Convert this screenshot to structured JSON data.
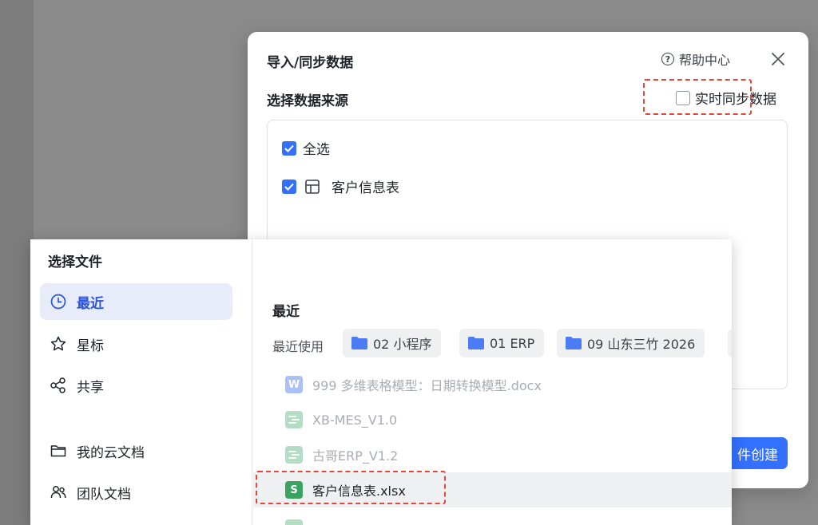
{
  "import_dialog": {
    "title": "导入/同步数据",
    "help_label": "帮助中心",
    "source_label": "选择数据来源",
    "realtime_sync_label": "实时同步数据",
    "select_all_label": "全选",
    "table_item_label": "客户信息表",
    "create_button_label": "件创建"
  },
  "file_picker": {
    "title": "选择文件",
    "nav": {
      "recent": "最近",
      "starred": "星标",
      "shared": "共享",
      "my_docs": "我的云文档",
      "team_docs": "团队文档"
    },
    "section_title": "最近",
    "recent_used_label": "最近使用",
    "folders": [
      "02 小程序",
      "01 ERP",
      "09 山东三竹 2026"
    ],
    "files": [
      {
        "name": "999 多维表格模型：日期转换模型.docx",
        "icon": "word-icon"
      },
      {
        "name": "XB-MES_V1.0",
        "icon": "base-icon"
      },
      {
        "name": "古哥ERP_V1.2",
        "icon": "base-icon"
      },
      {
        "name": "客户信息表.xlsx",
        "icon": "sheet-icon"
      }
    ]
  },
  "colors": {
    "accent": "#3370ff",
    "highlight_dash": "#e0483c",
    "folder": "#4c7cf5",
    "sheet_icon": "#3aa35f",
    "word_icon": "#a9c1f7",
    "base_icon": "#b5ddc6"
  }
}
